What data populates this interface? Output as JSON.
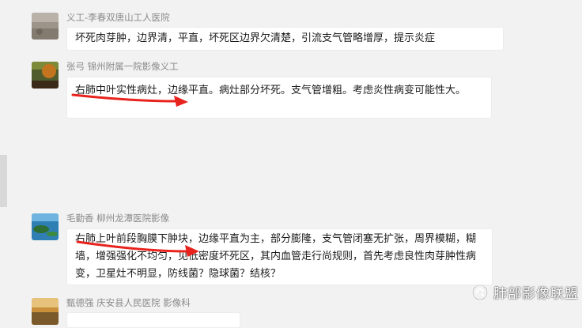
{
  "messages": [
    {
      "sender": "义工-李春双唐山工人医院",
      "text": "坏死肉芽肿，边界清，平直，坏死区边界欠清楚，引流支气管略增厚，提示炎症"
    },
    {
      "sender": "张弓 锦州附属一院影像义工",
      "text": "右肺中叶实性病灶，边缘平直。病灶部分坏死。支气管增粗。考虑炎性病变可能性大。"
    },
    {
      "sender": "毛勤香 柳州龙潭医院影像",
      "text": "右肺上叶前段胸膜下肿块，边缘平直为主，部分膨隆，支气管闭塞无扩张，周界模糊，糊墙，增强强化不均匀，见低密度坏死区，其内血管走行尚规则，首先考虑良性肉芽肿性病变，卫星灶不明显，防线菌？隐球菌？结核？"
    },
    {
      "sender": "甄德强 庆安县人民医院 影像科"
    }
  ],
  "watermark": {
    "text": "肺部影像联盟",
    "icon": "wechat-official-account-icon"
  },
  "colors": {
    "background": "#f2f2f2",
    "bubble": "#ffffff",
    "sender": "#8a8a8a",
    "arrow": "#e8231d"
  }
}
